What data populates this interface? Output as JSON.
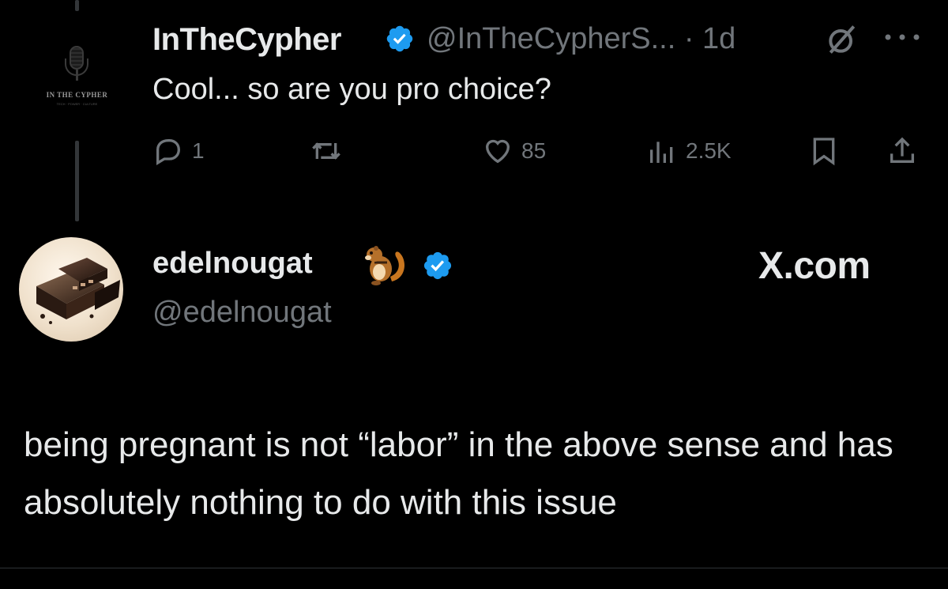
{
  "tweet1": {
    "author_name": "InTheCypher",
    "meta": "@InTheCypherS... · 1d",
    "avatar_text": "IN THE CYPHER",
    "avatar_subtext": "TECH · POWER · CULTURE",
    "text": "Cool... so are you pro choice?",
    "replies": "1",
    "retweets": "",
    "likes": "85",
    "views": "2.5K"
  },
  "tweet2": {
    "author_name": "edelnougat",
    "handle": "@edelnougat",
    "brand": "X.com",
    "text": "being pregnant is not “labor” in the above sense and has absolutely nothing to do with this issue"
  },
  "icons": {
    "verified": "verified-badge-icon",
    "grok": "grok-icon",
    "more": "more-dots-icon",
    "reply": "reply-icon",
    "retweet": "retweet-icon",
    "like": "heart-icon",
    "views": "views-icon",
    "bookmark": "bookmark-icon",
    "share": "share-icon",
    "emoji": "chipmunk-emoji"
  },
  "colors": {
    "background": "#000000",
    "text_primary": "#e7e9ea",
    "text_secondary": "#71767b",
    "verified_blue": "#1d9bf0"
  }
}
